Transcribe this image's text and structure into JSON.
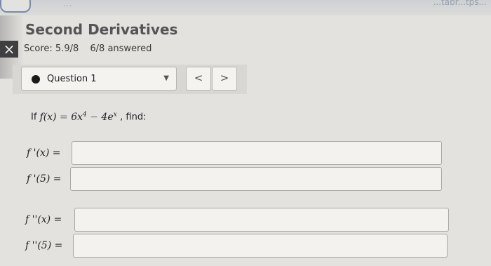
{
  "browser": {
    "tab_fragment_left": "...",
    "tab_fragment_right": "...tabr...tps..."
  },
  "page": {
    "title": "Second Derivatives",
    "score": "Score: 5.9/8",
    "answered": "6/8 answered",
    "close_icon": "×"
  },
  "question_nav": {
    "selected": "Question 1",
    "dropdown_icon": "▼",
    "prev_icon": "<",
    "next_icon": ">"
  },
  "problem": {
    "prefix": "If",
    "function_lhs": "f(x)",
    "equals": "=",
    "function_rhs_a": "6x",
    "exp_a": "4",
    "minus": "−",
    "function_rhs_b": "4e",
    "exp_b": "x",
    "suffix": ", find:"
  },
  "answers": [
    {
      "label": "f '(x) =",
      "value": ""
    },
    {
      "label": "f '(5) =",
      "value": ""
    },
    {
      "label": "f ''(x) =",
      "value": ""
    },
    {
      "label": "f ''(5) =",
      "value": ""
    }
  ]
}
